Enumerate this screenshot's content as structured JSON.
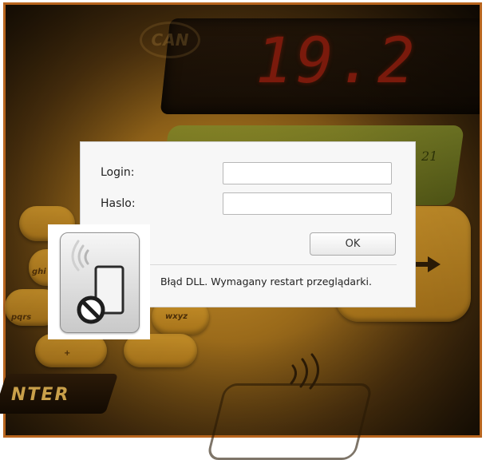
{
  "background": {
    "display_value": "19.2",
    "brand_text": "CAN",
    "key_text": "21",
    "pad_labels": [
      "ghi",
      "pqrs",
      "wxyz",
      "+"
    ],
    "enter_label": "NTER"
  },
  "login_dialog": {
    "login_label": "Login:",
    "login_value": "",
    "password_label": "Haslo:",
    "password_value": "",
    "ok_label": "OK",
    "error_message": "Błąd DLL. Wymagany restart przeglądarki."
  },
  "icon": {
    "name": "device-blocked-icon"
  },
  "colors": {
    "frame_border": "#b8651e",
    "dialog_background": "#f7f7f7",
    "display_digits": "#7a1a0c"
  }
}
